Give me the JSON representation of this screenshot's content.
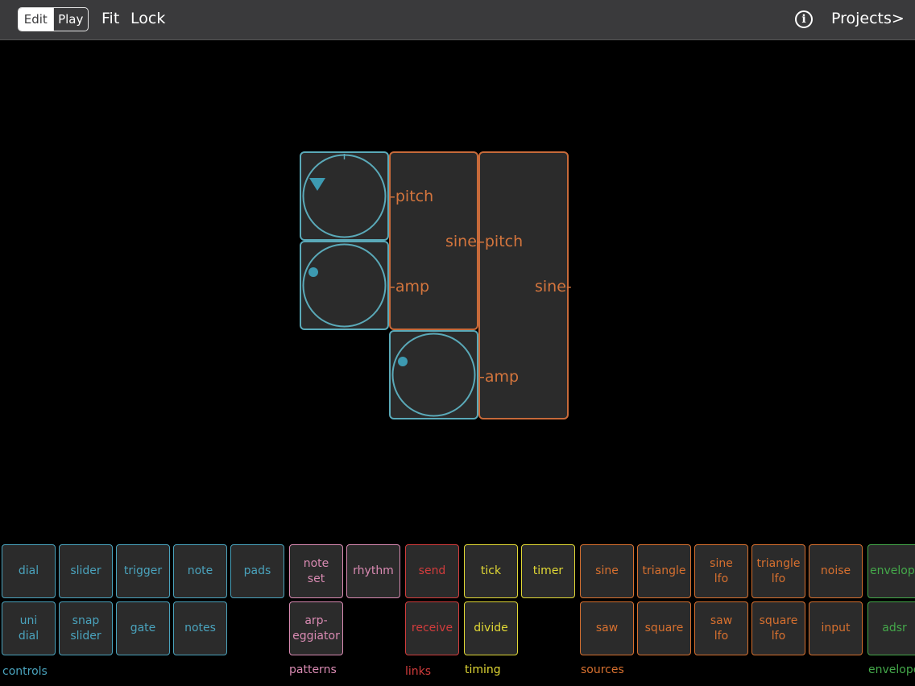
{
  "toolbar": {
    "edit_label": "Edit",
    "play_label": "Play",
    "fit_label": "Fit",
    "lock_label": "Lock",
    "projects_label": "Projects>",
    "info_glyph": "i"
  },
  "canvas": {
    "ports": {
      "pitch_in": "pitch",
      "amp_in": "amp",
      "sine_out_1": "sine",
      "pitch_in_2": "pitch",
      "sine_out_2": "sine",
      "amp_in_2": "amp"
    },
    "dial_color": "#5aa9b8",
    "module_color": "#c76a3a"
  },
  "palette": {
    "controls": {
      "label": "controls",
      "items": [
        "dial",
        "slider",
        "trigger",
        "note",
        "pads",
        "uni\ndial",
        "snap\nslider",
        "gate",
        "notes"
      ]
    },
    "patterns": {
      "label": "patterns",
      "items": [
        "note\nset",
        "rhythm",
        "arp-\neggiator"
      ]
    },
    "links": {
      "label": "links",
      "items": [
        "send",
        "receive"
      ]
    },
    "timing": {
      "label": "timing",
      "items": [
        "tick",
        "timer",
        "divide"
      ]
    },
    "sources": {
      "label": "sources",
      "items": [
        "sine",
        "triangle",
        "sine\nlfo",
        "triangle\nlfo",
        "noise",
        "saw",
        "square",
        "saw\nlfo",
        "square\nlfo",
        "input"
      ]
    },
    "envelopes": {
      "label": "envelope",
      "items": [
        "envelope",
        "adsr"
      ]
    }
  },
  "colors": {
    "controls": "#4aa3bd",
    "patterns": "#d98ab2",
    "links": "#d23c3c",
    "timing": "#e1d835",
    "sources": "#d7702f",
    "envelopes": "#44a84a"
  }
}
